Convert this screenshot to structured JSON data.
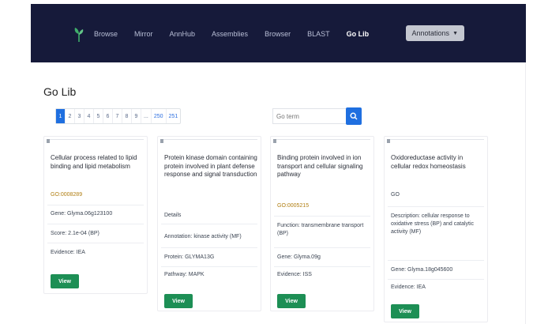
{
  "navbar": {
    "links": [
      "Browse",
      "Mirror",
      "AnnHub",
      "Assemblies",
      "Browser",
      "BLAST"
    ],
    "active": "Go Lib",
    "select_label": "Annotations"
  },
  "heading": "Go Lib",
  "pagination": {
    "pages": [
      "1",
      "2",
      "3",
      "4",
      "5",
      "6",
      "7",
      "8",
      "9",
      "...",
      "250",
      "251"
    ],
    "active_index": 0
  },
  "search": {
    "placeholder": "Go term",
    "icon": "search-icon"
  },
  "cards": [
    {
      "title": "Cellular process related to lipid binding and lipid metabolism",
      "tag": "GO:0008289",
      "fields": [
        "Gene: Glyma.06g123100",
        "Score: 2.1e-04 (BP)",
        "Evidence: IEA"
      ],
      "button": "View"
    },
    {
      "title": "Protein kinase domain containing protein involved in plant defense response and signal transduction",
      "tag": "Details",
      "fields": [
        "Annotation: kinase activity (MF)",
        "Protein: GLYMA13G",
        "Pathway: MAPK"
      ],
      "button": "View"
    },
    {
      "title": "Binding protein involved in ion transport and cellular signaling pathway",
      "tag": "GO:0005215",
      "fields": [
        "Function: transmembrane transport (BP)",
        "Gene: Glyma.09g",
        "Evidence: ISS"
      ],
      "button": "View"
    },
    {
      "title": "Oxidoreductase activity in cellular redox homeostasis",
      "tag": "GO",
      "fields": [
        "Description: cellular response to oxidative stress (BP) and catalytic activity (MF)",
        "Gene: Glyma.18g045600",
        "Evidence: IEA"
      ],
      "button": "View"
    }
  ],
  "colors": {
    "nav_bg": "#161a3a",
    "primary": "#1f6fe0",
    "success": "#1d8f55"
  }
}
